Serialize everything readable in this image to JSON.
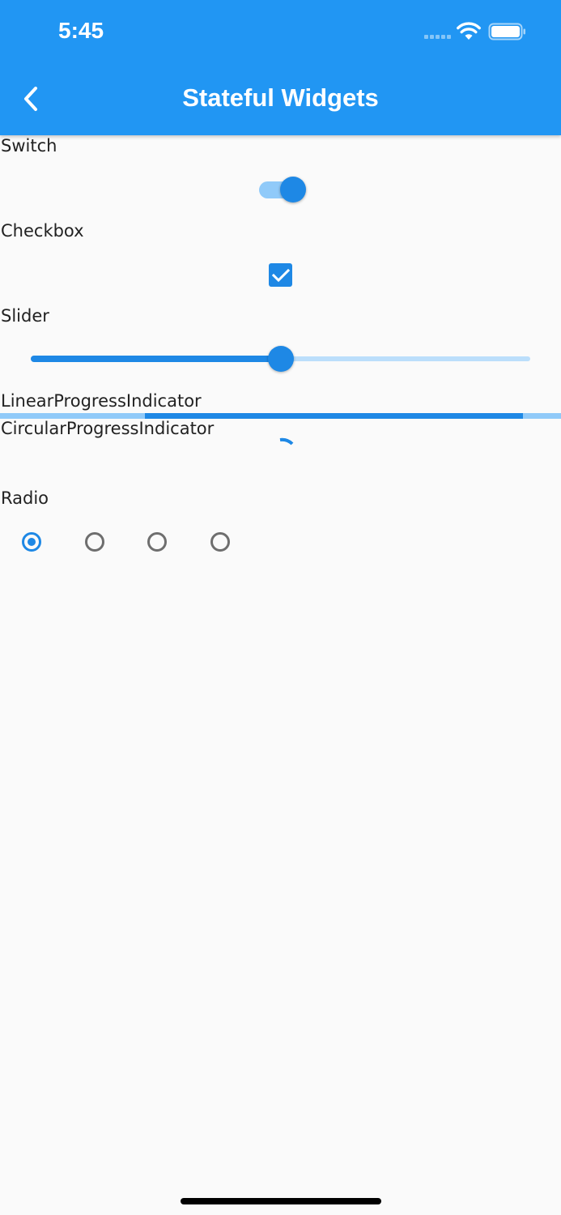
{
  "status_bar": {
    "time": "5:45"
  },
  "app_bar": {
    "title": "Stateful Widgets",
    "back_icon": "chevron-left-icon"
  },
  "colors": {
    "primary": "#2196f3",
    "accent": "#1e88e5",
    "light_accent": "#90caf9",
    "background": "#fafafa"
  },
  "switch": {
    "label": "Switch",
    "on": true
  },
  "checkbox": {
    "label": "Checkbox",
    "checked": true
  },
  "slider": {
    "label": "Slider",
    "value": 0.5
  },
  "linear_progress": {
    "label": "LinearProgressIndicator",
    "indeterminate": true
  },
  "circular_progress": {
    "label": "CircularProgressIndicator",
    "indeterminate": true
  },
  "radio": {
    "label": "Radio",
    "options": 4,
    "selected_index": 0
  }
}
